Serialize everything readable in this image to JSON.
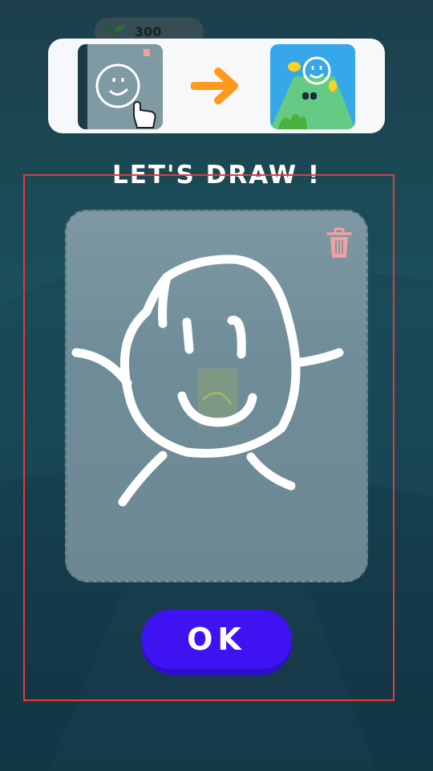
{
  "hud": {
    "coins": "300",
    "coin_icon": "sprout-icon"
  },
  "hint": {
    "draw_icon": "draw-face-hint-icon",
    "arrow_icon": "arrow-right-icon",
    "result_icon": "game-preview-icon"
  },
  "title": "LET'S DRAW !",
  "canvas": {
    "trash_icon": "trash-icon",
    "drawing": "stick-figure-face"
  },
  "ok_button": {
    "label": "OK"
  },
  "colors": {
    "button": "#3f12f2",
    "arrow": "#ff9a1f",
    "trash": "#f2a0a0",
    "focus_frame": "#e53a3a"
  }
}
